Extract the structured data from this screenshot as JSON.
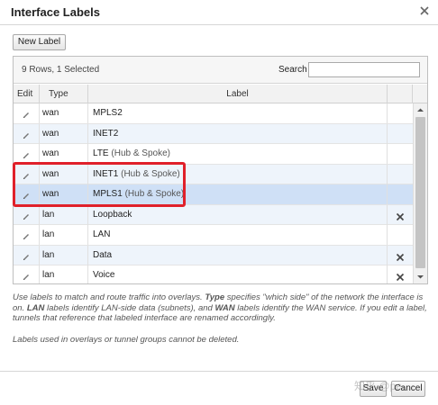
{
  "dialog": {
    "title": "Interface Labels",
    "close_icon": "close-icon"
  },
  "toolbar": {
    "new_label": "New Label"
  },
  "grid": {
    "rows_info": "9 Rows, 1 Selected",
    "search_label": "Search",
    "search_value": "",
    "columns": {
      "edit": "Edit",
      "type": "Type",
      "label": "Label"
    },
    "rows": [
      {
        "type": "wan",
        "label": "MPLS2",
        "suffix": "",
        "deletable": false,
        "selected": false
      },
      {
        "type": "wan",
        "label": "INET2",
        "suffix": "",
        "deletable": false,
        "selected": false
      },
      {
        "type": "wan",
        "label": "LTE",
        "suffix": " (Hub & Spoke)",
        "deletable": false,
        "selected": false
      },
      {
        "type": "wan",
        "label": "INET1",
        "suffix": " (Hub & Spoke)",
        "deletable": false,
        "selected": false
      },
      {
        "type": "wan",
        "label": "MPLS1",
        "suffix": " (Hub & Spoke)",
        "deletable": false,
        "selected": true
      },
      {
        "type": "lan",
        "label": "Loopback",
        "suffix": "",
        "deletable": true,
        "selected": false
      },
      {
        "type": "lan",
        "label": "LAN",
        "suffix": "",
        "deletable": false,
        "selected": false
      },
      {
        "type": "lan",
        "label": "Data",
        "suffix": "",
        "deletable": true,
        "selected": false
      },
      {
        "type": "lan",
        "label": "Voice",
        "suffix": "",
        "deletable": true,
        "selected": false
      }
    ]
  },
  "help": {
    "p1_a": "Use labels to match and route traffic into overlays. ",
    "p1_b": "Type",
    "p1_c": " specifies \"which side\" of the network the interface is on. ",
    "p1_d": "LAN",
    "p1_e": " labels identify LAN-side data (subnets), and ",
    "p1_f": "WAN",
    "p1_g": " labels identify the WAN service. If you edit a label, tunnels that reference that labeled interface are renamed accordingly.",
    "p2": "Labels used in overlays or tunnel groups cannot be deleted."
  },
  "footer": {
    "save": "Save",
    "cancel": "Cancel",
    "watermark": "知乎 @pe..."
  },
  "colors": {
    "highlight": "#e0202a",
    "selected_row": "#cfe0f6",
    "alt_row": "#eef4fb"
  }
}
